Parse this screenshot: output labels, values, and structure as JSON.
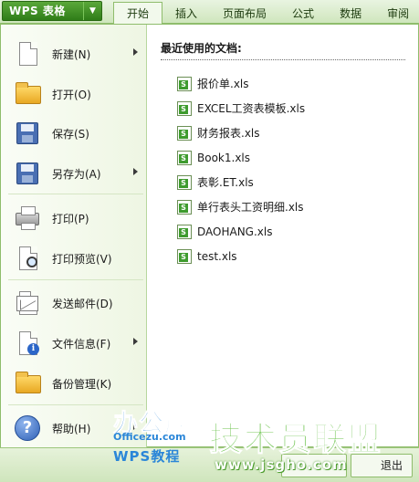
{
  "app": {
    "name": "WPS 表格"
  },
  "tabs": [
    {
      "label": "开始"
    },
    {
      "label": "插入"
    },
    {
      "label": "页面布局"
    },
    {
      "label": "公式"
    },
    {
      "label": "数据"
    },
    {
      "label": "审阅"
    }
  ],
  "menu": [
    {
      "label": "新建(N)",
      "icon": "new-document-icon",
      "submenu": true
    },
    {
      "label": "打开(O)",
      "icon": "open-folder-icon",
      "submenu": false
    },
    {
      "label": "保存(S)",
      "icon": "save-disk-icon",
      "submenu": false
    },
    {
      "label": "另存为(A)",
      "icon": "save-as-icon",
      "submenu": true
    },
    {
      "label": "打印(P)",
      "icon": "printer-icon",
      "submenu": false
    },
    {
      "label": "打印预览(V)",
      "icon": "print-preview-icon",
      "submenu": false
    },
    {
      "label": "发送邮件(D)",
      "icon": "email-icon",
      "submenu": false
    },
    {
      "label": "文件信息(F)",
      "icon": "file-info-icon",
      "submenu": true
    },
    {
      "label": "备份管理(K)",
      "icon": "backup-folder-icon",
      "submenu": false
    },
    {
      "label": "帮助(H)",
      "icon": "help-icon",
      "submenu": true
    }
  ],
  "recent": {
    "title": "最近使用的文档:",
    "files": [
      "报价单.xls",
      "EXCEL工资表模板.xls",
      "财务报表.xls",
      "Book1.xls",
      "表彰.ET.xls",
      "单行表头工资明细.xls",
      "DAOHANG.xls",
      "test.xls"
    ]
  },
  "bottom": {
    "exit_label": "退出"
  },
  "watermarks": {
    "officezu_brand": "办公族",
    "officezu_domain": "Officezu.com",
    "officezu_sub": "WPS教程",
    "jsgho_brand": "技术员联盟",
    "jsgho_url": "www.jsgho.com"
  },
  "colors": {
    "accent_green": "#2f7d18",
    "panel_border": "#8fbd6c",
    "watermark_blue": "#2a86d8",
    "watermark_green": "#6cc34d"
  }
}
